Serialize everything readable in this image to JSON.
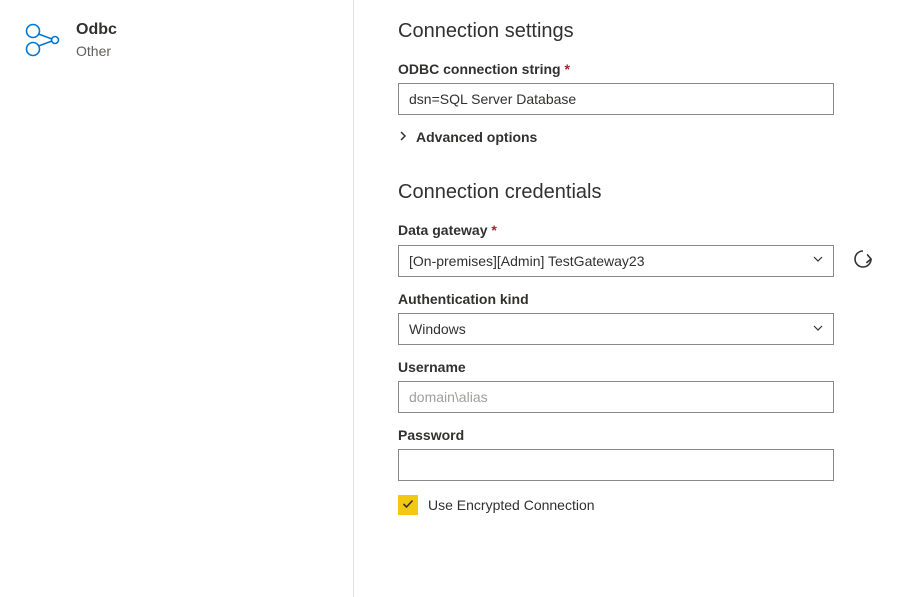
{
  "connector": {
    "title": "Odbc",
    "subtitle": "Other"
  },
  "settings": {
    "heading": "Connection settings",
    "connectionString": {
      "label": "ODBC connection string",
      "required": "*",
      "value": "dsn=SQL Server Database"
    },
    "advancedOptions": "Advanced options"
  },
  "credentials": {
    "heading": "Connection credentials",
    "gateway": {
      "label": "Data gateway",
      "required": "*",
      "value": "[On-premises][Admin] TestGateway23"
    },
    "authKind": {
      "label": "Authentication kind",
      "value": "Windows"
    },
    "username": {
      "label": "Username",
      "placeholder": "domain\\alias",
      "value": ""
    },
    "password": {
      "label": "Password",
      "value": ""
    },
    "encrypted": {
      "label": "Use Encrypted Connection",
      "checked": true
    }
  }
}
